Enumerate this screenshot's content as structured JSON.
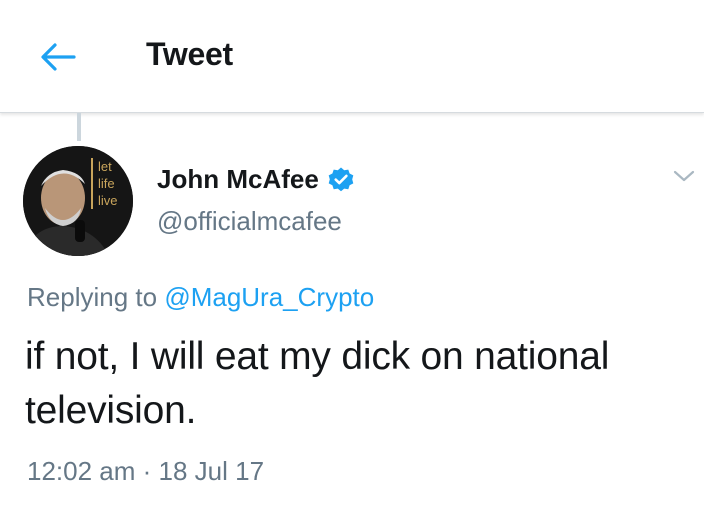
{
  "header": {
    "back_icon": "arrow-left-icon",
    "title": "Tweet",
    "accent_color": "#1da1f2"
  },
  "tweet": {
    "author": {
      "display_name": "John McAfee",
      "handle": "@officialmcafee",
      "verified": true,
      "avatar_overlay_text": [
        "let",
        "life",
        "live"
      ]
    },
    "menu_icon": "chevron-down-icon",
    "replying_to_prefix": "Replying to ",
    "replying_to_handle": "@MagUra_Crypto",
    "text": "if not, I will eat my dick on national television.",
    "timestamp": "12:02 am · 18 Jul 17"
  }
}
